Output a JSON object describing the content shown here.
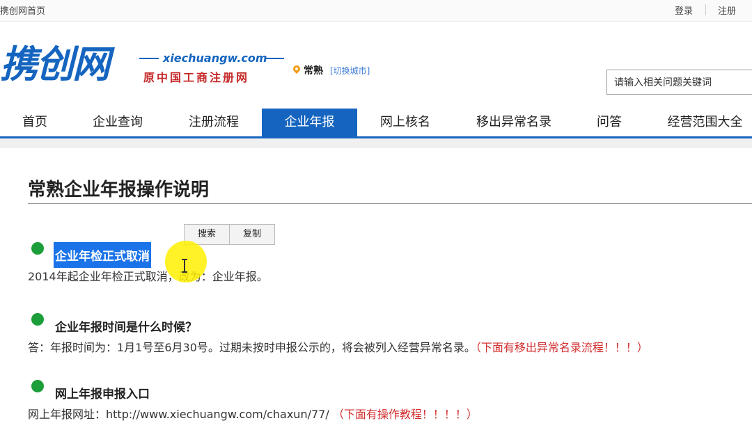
{
  "topbar": {
    "home": "携创网首页",
    "login": "登录",
    "register": "注册"
  },
  "logo": {
    "text": "携创网",
    "url": "xiechuangw.com",
    "subtitle": "原中国工商注册网"
  },
  "city": {
    "name": "常熟",
    "switch": "[切换城市]"
  },
  "search": {
    "placeholder": "请输入相关问题关键词"
  },
  "nav": {
    "items": [
      {
        "label": "首页"
      },
      {
        "label": "企业查询"
      },
      {
        "label": "注册流程"
      },
      {
        "label": "企业年报"
      },
      {
        "label": "网上核名"
      },
      {
        "label": "移出异常名录"
      },
      {
        "label": "问答"
      },
      {
        "label": "经营范围大全"
      }
    ],
    "active": "企业年报"
  },
  "article": {
    "title": "常熟企业年报操作说明",
    "popup": {
      "search": "搜索",
      "copy": "复制"
    },
    "sections": [
      {
        "heading": "企业年检正式取消",
        "body": "2014年起企业年检正式取消，改为：企业年报。"
      },
      {
        "heading": "企业年报时间是什么时候？",
        "body": "答：年报时间为：1月1号至6月30号。过期未按时申报公示的，将会被列入经营异常名录。",
        "note": "（下面有移出异常名录流程！！！）"
      },
      {
        "heading": "网上年报申报入口",
        "body": "网上年报网址：http://www.xiechuangw.com/chaxun/77/",
        "note": "（下面有操作教程！！！！）"
      }
    ]
  },
  "colors": {
    "brand": "#1565c0",
    "accent_red": "#d32f2f",
    "bullet": "#1c9e3a",
    "selection": "#1a73e8"
  }
}
